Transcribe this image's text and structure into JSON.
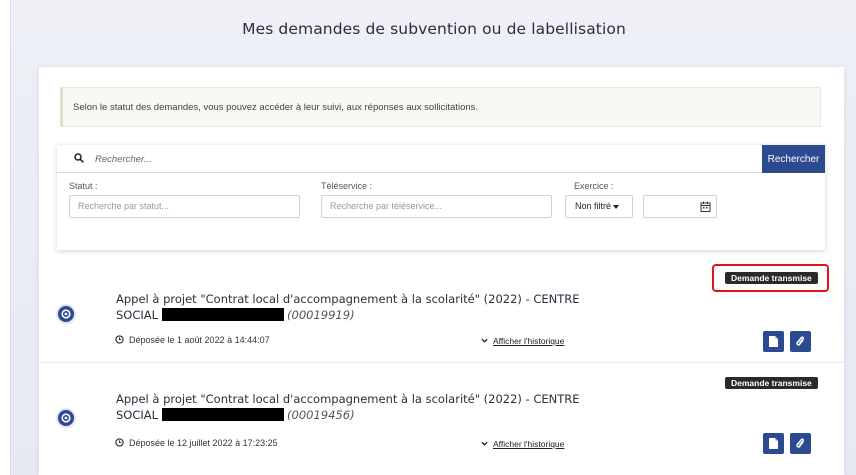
{
  "page_title": "Mes demandes de subvention ou de labellisation",
  "info_text": "Selon le statut des demandes, vous pouvez accéder à leur suivi, aux réponses aux sollicitations.",
  "search": {
    "placeholder": "Rechercher...",
    "button_label": "Rechercher"
  },
  "filters": {
    "statut_label": "Statut :",
    "statut_placeholder": "Recherche par statut...",
    "teleservice_label": "Téléservice :",
    "teleservice_placeholder": "Recherche par téléservice...",
    "exercice_label": "Exercice :",
    "exercice_value": "Non filtré",
    "year_value": ""
  },
  "requests": [
    {
      "status": "Demande transmise",
      "title_line1": "Appel à projet \"Contrat local d'accompagnement à la scolarité\" (2022) - CENTRE",
      "title_line2": "SOCIAL",
      "reference": "(00019919)",
      "date": "Déposée le 1 août 2022 à 14:44:07",
      "history_link": "Afficher l'historique"
    },
    {
      "status": "Demande transmise",
      "title_line1": "Appel à projet \"Contrat local d'accompagnement à la scolarité\" (2022) - CENTRE",
      "title_line2": "SOCIAL",
      "reference": "(00019456)",
      "date": "Déposée le 12 juillet 2022 à 17:23:25",
      "history_link": "Afficher l'historique"
    }
  ],
  "colors": {
    "primary": "#2c4a90",
    "badge": "#2a2a2a",
    "highlight": "#e0141a"
  }
}
